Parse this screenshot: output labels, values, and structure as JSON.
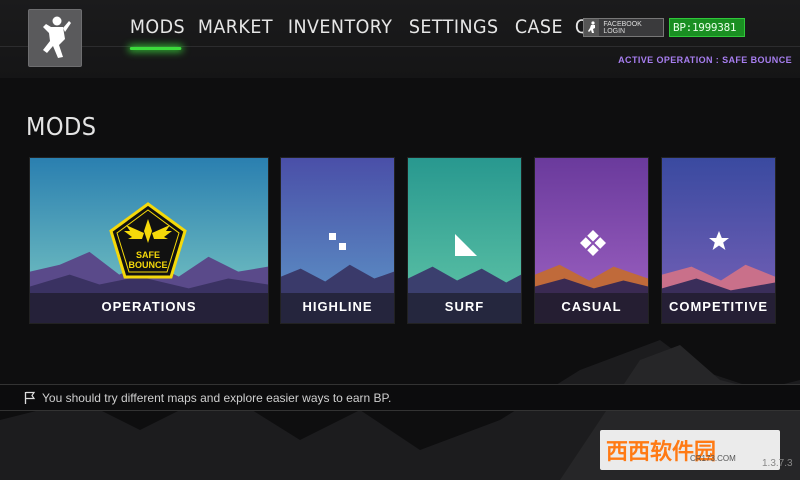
{
  "nav": {
    "items": [
      {
        "label": "MODS",
        "active": true
      },
      {
        "label": "MARKET"
      },
      {
        "label": "INVENTORY"
      },
      {
        "label": "SETTINGS"
      },
      {
        "label": "CASE"
      },
      {
        "label": "QUIT"
      }
    ]
  },
  "account": {
    "facebook_label": "FACEBOOK LOGIN",
    "bp_label": "BP:1999381"
  },
  "active_operation": "ACTIVE OPERATION : SAFE BOUNCE",
  "section_title": "MODS",
  "badge_text": [
    "SAFE",
    "BOUNCE"
  ],
  "cards": [
    {
      "label": "OPERATIONS",
      "icon": "safe-bounce-badge-icon",
      "sky": [
        "#2f8fb8",
        "#6fc4c9"
      ]
    },
    {
      "label": "HIGHLINE",
      "icon": "squares-icon",
      "sky": [
        "#4a5ea8",
        "#5f8dbf"
      ]
    },
    {
      "label": "SURF",
      "icon": "triangle-icon",
      "sky": [
        "#2c9b8c",
        "#5fc4a8"
      ]
    },
    {
      "label": "CASUAL",
      "icon": "diamond-icon",
      "sky": [
        "#6e3a9c",
        "#9b62c4"
      ]
    },
    {
      "label": "COMPETITIVE",
      "icon": "star-icon",
      "sky": [
        "#3a4f9c",
        "#6b62b8"
      ]
    }
  ],
  "tip": "You should try different maps and explore easier ways to earn BP.",
  "watermark": {
    "brand": "西西软件园",
    "url": "CR173.COM"
  },
  "version": "1.3.7.3",
  "colors": {
    "accent_green": "#3bdc3b",
    "bp_green": "#1a8f22",
    "operation_purple": "#a77ef0",
    "badge_yellow": "#f5d90a"
  }
}
